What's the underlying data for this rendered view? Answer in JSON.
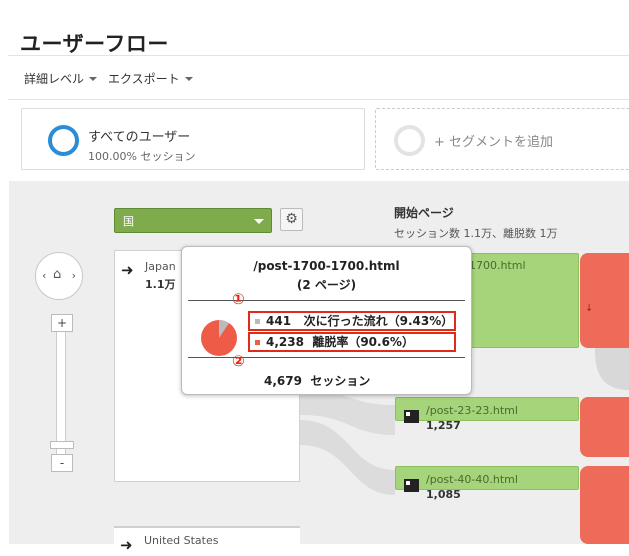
{
  "page": {
    "title": "ユーザーフロー"
  },
  "toolbar": {
    "detail_label": "詳細レベル",
    "export_label": "エクスポート"
  },
  "segments": {
    "active": {
      "name": "すべてのユーザー",
      "sub": "100.00% セッション",
      "color": "#2b8cd8"
    },
    "add": {
      "label": "+ セグメントを追加"
    }
  },
  "controls": {
    "dimension_value": "国",
    "gear_icon": "gear-icon",
    "nav_left": "‹",
    "nav_right": "›",
    "home_icon": "⌂",
    "zoom_in": "+",
    "zoom_out": "-"
  },
  "column": {
    "title": "開始ページ",
    "subtitle": "セッション数 1.1万、離脱数 1万"
  },
  "source_nodes": [
    {
      "label": "Japan",
      "value": "1.1万"
    },
    {
      "label": "United States",
      "value": ""
    }
  ],
  "page_nodes": [
    {
      "label": "0-1700.html",
      "value": ""
    },
    {
      "label": "/post-23-23.html",
      "value": "1,257"
    },
    {
      "label": "/post-40-40.html",
      "value": "1,085"
    }
  ],
  "tooltip": {
    "title": "/post-1700-1700.html",
    "pages": "(2 ページ)",
    "rows": [
      {
        "count": "441",
        "text": "次に行った流れ（9.43%）",
        "color": "#bbbbbb",
        "fraction": 0.0943
      },
      {
        "count": "4,238",
        "text": "離脱率（90.6%）",
        "color": "#ee5c48",
        "fraction": 0.906
      }
    ],
    "sessions": "4,679",
    "sessions_label": "セッション",
    "badges": [
      "①",
      "②"
    ]
  },
  "colors": {
    "green": "#a6d47a",
    "drop": "#ee6b5a",
    "accent_red": "#e02a1a"
  }
}
